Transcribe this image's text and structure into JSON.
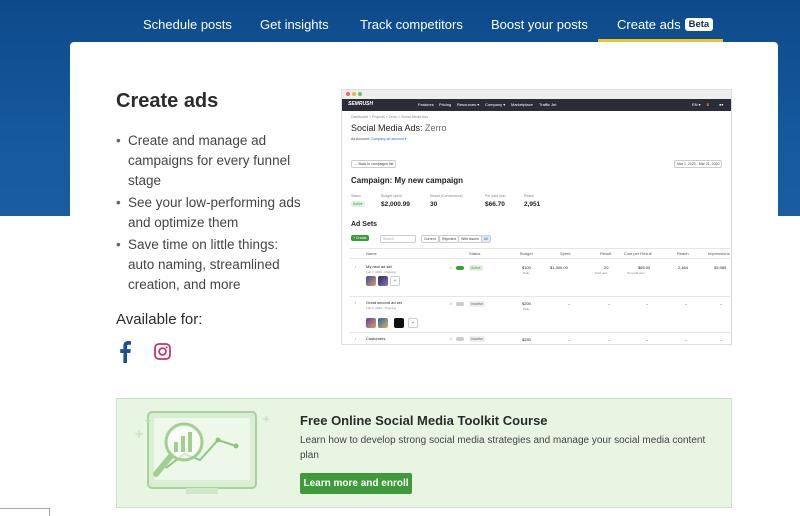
{
  "nav": {
    "tabs": [
      {
        "label": "Schedule posts"
      },
      {
        "label": "Get insights"
      },
      {
        "label": "Track competitors"
      },
      {
        "label": "Boost your posts"
      },
      {
        "label": "Create ads",
        "badge": "Beta",
        "active": true
      }
    ]
  },
  "section": {
    "title": "Create ads",
    "bullets": [
      "Create and manage ad campaigns for every funnel stage",
      "See your low-performing ads and optimize them",
      "Save time on little things: auto naming, streamlined creation, and more"
    ],
    "available_label": "Available for:",
    "platforms": [
      "facebook-icon",
      "instagram-icon"
    ]
  },
  "screenshot": {
    "logo": "SEMRUSH",
    "menu": [
      "Features",
      "Pricing",
      "Resources ▾",
      "Company ▾",
      "Marketplace",
      "Traffic Jet"
    ],
    "lang": "EN ▾",
    "breadcrumb": "Dashboard  >  Projects  >  Zerro  >  Social Media Ads",
    "page_title": "Social Media Ads: ",
    "page_title_project": "Zerro",
    "ad_account": "Ad Account: ",
    "ad_account_value": "Company ad account ▾",
    "back_button": "← Back to campaigns list",
    "date_range": "Mar 1, 2020 - Mar 21, 2020",
    "campaign_title": "Campaign: My new campaign",
    "stats": [
      {
        "label": "Status",
        "value": "Active"
      },
      {
        "label": "Budget spent",
        "value": "$2,000.99"
      },
      {
        "label": "Result (Conversions)",
        "value": "30"
      },
      {
        "label": "Per paid user",
        "value": "$66.70"
      },
      {
        "label": "Reach",
        "value": "2,951"
      }
    ],
    "ad_sets_title": "Ad Sets",
    "create_button": "+ Create",
    "search_placeholder": "Search",
    "filters": [
      "Current",
      "Rejected",
      "With issues",
      "All"
    ],
    "columns": [
      "Name",
      "Status",
      "Budget",
      "Spent",
      "Result",
      "Cost per Result",
      "Reach",
      "Impressions"
    ],
    "rows": [
      {
        "name": "My new ad set",
        "date": "Feb 7, 2020 - Ongoing",
        "status": "Active",
        "budget": "$100",
        "budget_sub": "Daily",
        "spent": "$1,300.00",
        "result": "20",
        "result_sub": "Paid user",
        "cost": "$65.00",
        "cost_sub": "Per paid user",
        "reach": "2,464",
        "impressions": "55,989"
      },
      {
        "name": "Great second ad set",
        "date": "Feb 3, 2020 - Ongoing",
        "status": "Inactive",
        "budget": "$200",
        "budget_sub": "Daily",
        "spent": "–",
        "result": "–",
        "result_sub": "",
        "cost": "–",
        "cost_sub": "",
        "reach": "–",
        "impressions": "–"
      },
      {
        "name": "Customers",
        "date": "",
        "status": "Inactive",
        "budget": "$250",
        "budget_sub": "",
        "spent": "–",
        "result": "–",
        "result_sub": "",
        "cost": "–",
        "cost_sub": "",
        "reach": "–",
        "impressions": "–"
      }
    ]
  },
  "banner": {
    "title": "Free Online Social Media Toolkit Course",
    "description": "Learn how to develop strong social media strategies and manage your social media content plan",
    "button": "Learn more and enroll"
  },
  "colors": {
    "hero": "#15589e",
    "accent": "#f2c31a",
    "facebook": "#1c4f9c",
    "instagram": "#c7336d",
    "banner_bg": "#e8f5e3",
    "button_green": "#3e9a3a"
  }
}
